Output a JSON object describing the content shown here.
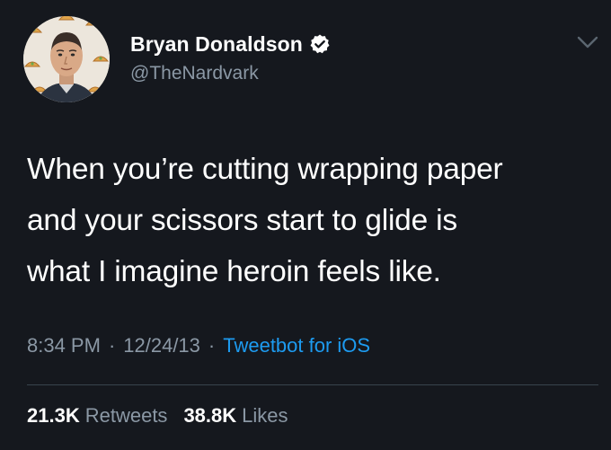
{
  "author": {
    "display_name": "Bryan Donaldson",
    "handle": "@TheNardvark",
    "verified_icon": "verified-badge-icon",
    "avatar": "avatar-photo"
  },
  "menu_icon": "chevron-down-icon",
  "tweet": {
    "text": "When you’re cutting wrapping paper\nand your scissors start to glide is\nwhat I imagine heroin feels like."
  },
  "meta": {
    "time": "8:34 PM",
    "separator": "·",
    "date": "12/24/13",
    "source": "Tweetbot for iOS"
  },
  "stats": {
    "retweets_count": "21.3K",
    "retweets_label": "Retweets",
    "likes_count": "38.8K",
    "likes_label": "Likes"
  },
  "colors": {
    "background": "#15181e",
    "text": "#ffffff",
    "secondary_text": "#8b98a5",
    "link": "#1d9bf0",
    "divider": "#38444d"
  }
}
